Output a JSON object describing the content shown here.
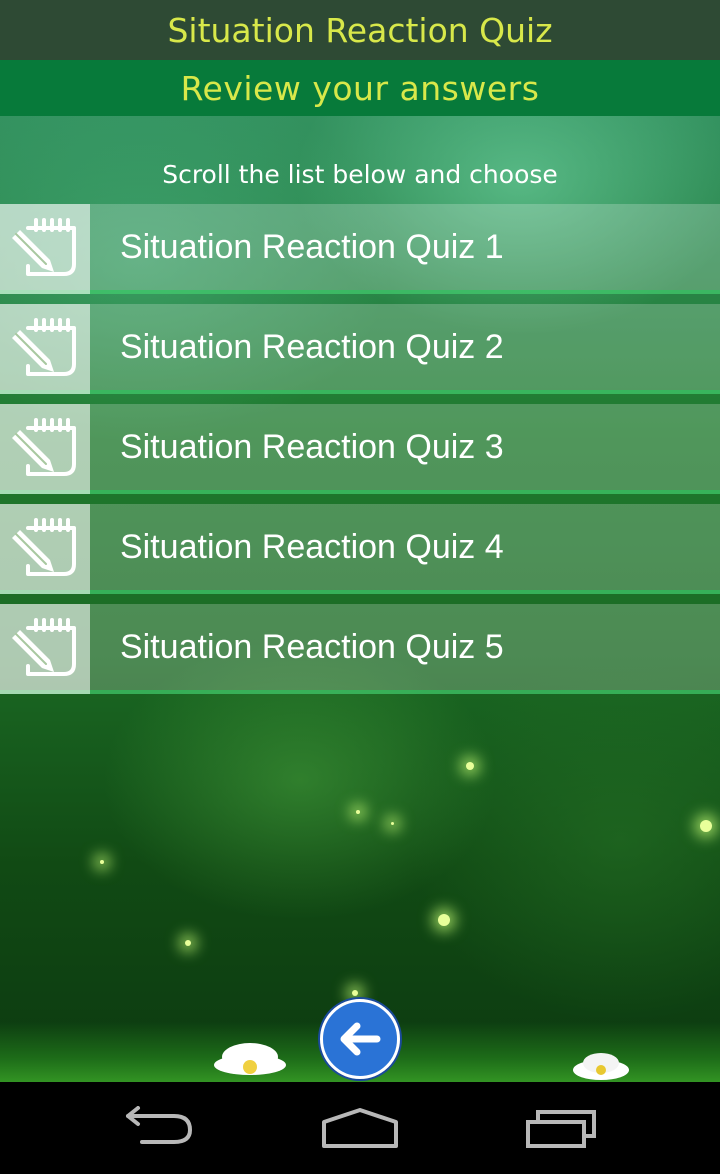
{
  "app": {
    "title": "Situation Reaction Quiz",
    "subtitle": "Review your answers"
  },
  "hint": "Scroll the list below and choose",
  "quizzes": [
    {
      "label": "Situation Reaction Quiz 1",
      "icon": "edit-notepad-icon"
    },
    {
      "label": "Situation Reaction Quiz 2",
      "icon": "edit-notepad-icon"
    },
    {
      "label": "Situation Reaction Quiz 3",
      "icon": "edit-notepad-icon"
    },
    {
      "label": "Situation Reaction Quiz 4",
      "icon": "edit-notepad-icon"
    },
    {
      "label": "Situation Reaction Quiz 5",
      "icon": "edit-notepad-icon"
    }
  ],
  "back_button": {
    "icon": "arrow-left-icon"
  },
  "navbar": {
    "back": "nav-back-icon",
    "home": "nav-home-icon",
    "recents": "nav-recents-icon"
  },
  "colors": {
    "title_text": "#d8e84a",
    "titlebar_bg": "#2e4a34",
    "subbar_bg": "#077a3a",
    "back_button_bg": "#2a73d6"
  }
}
